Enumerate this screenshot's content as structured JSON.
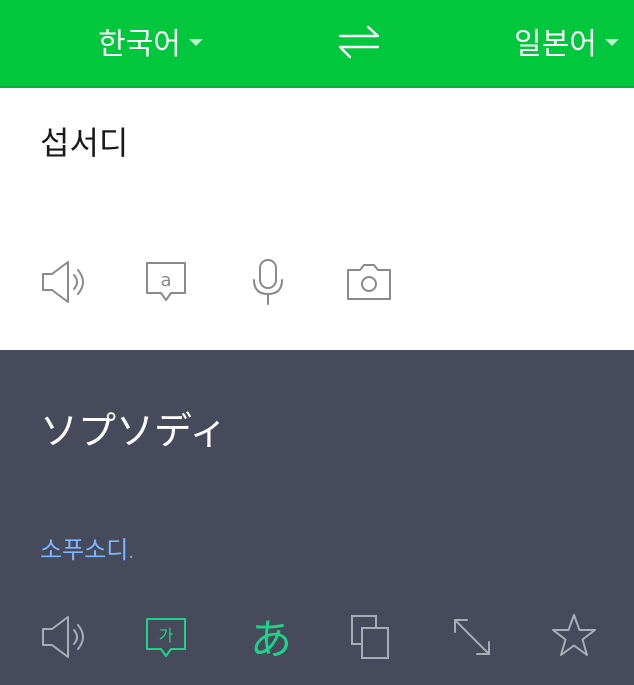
{
  "header": {
    "source_language": "한국어",
    "target_language": "일본어",
    "accent_color": "#00c73c"
  },
  "input": {
    "text": "섭서디",
    "icons": [
      "speaker-icon",
      "phonetic-a-icon",
      "microphone-icon",
      "camera-icon"
    ]
  },
  "output": {
    "translation": "ソプソディ",
    "pronunciation": "소푸소디",
    "pronunciation_suffix": ".",
    "pronunciation_color": "#7db7ff",
    "background_color": "#464a5a",
    "icons": [
      "speaker-icon",
      "hangul-ga-icon",
      "hiragana-a-icon",
      "copy-icon",
      "expand-icon",
      "star-icon"
    ]
  }
}
